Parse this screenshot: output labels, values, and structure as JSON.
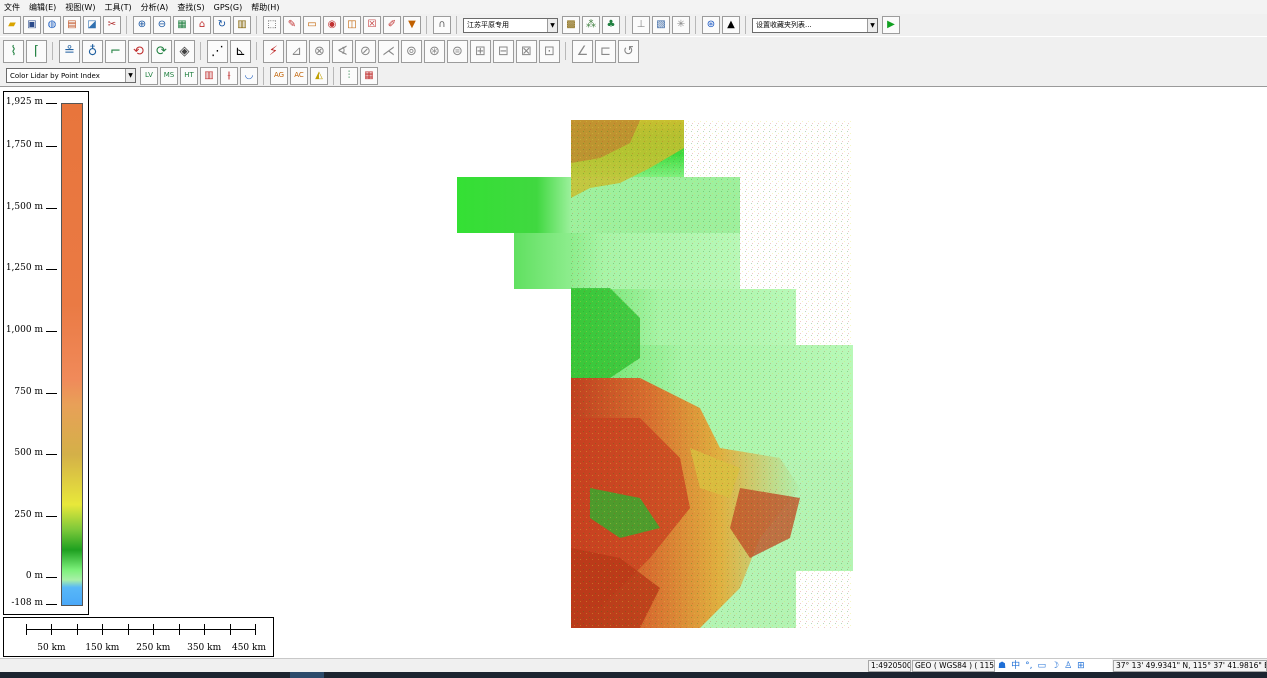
{
  "menu": [
    "文件",
    "编辑(E)",
    "视图(W)",
    "工具(T)",
    "分析(A)",
    "查找(S)",
    "GPS(G)",
    "帮助(H)"
  ],
  "toolbar1": {
    "group1_icons": [
      "open-folder-icon",
      "save-icon",
      "globe-icon",
      "layers-icon",
      "overlay-icon",
      "tools-icon"
    ],
    "group2_icons": [
      "zoom-in-icon",
      "zoom-out-icon",
      "map-view-icon",
      "home-icon",
      "refresh-icon",
      "grid-view-icon"
    ],
    "group3_icons": [
      "select-icon",
      "measure-icon",
      "ruler-icon",
      "query-icon",
      "area-icon",
      "edit-map-icon",
      "pencil-icon",
      "down-arrow-icon"
    ],
    "group4_icons": [
      "arch-icon"
    ],
    "projection_select": "江苏平原专用",
    "group5_icons": [
      "paint-icon",
      "dots-icon",
      "tree-icon"
    ],
    "group6_icons": [
      "elevation-icon",
      "export-icon",
      "star-icon"
    ],
    "group7_icons": [
      "target-icon",
      "north-arrow-icon"
    ],
    "favorites_select": "设置收藏夹列表...",
    "play_icon": "play-icon"
  },
  "toolbar2": {
    "icons": [
      "digitize-line-icon",
      "digitize-area-icon",
      "digitize-point-icon",
      "move-feature-icon",
      "edit-vertex-icon",
      "rotate-icon",
      "fill-icon",
      "dots-select-icon",
      "split-icon",
      "edit-path-icon",
      "trace-icon",
      "smooth-icon",
      "join-icon",
      "reshape-icon",
      "cut-icon",
      "merge-icon",
      "offset-icon",
      "buffer-icon",
      "intersect-icon",
      "union-icon",
      "clip-icon",
      "erase-icon",
      "simplify-icon",
      "undo-edit-icon",
      "redo-edit-icon",
      "close-edit-icon"
    ]
  },
  "toolbar3": {
    "lidar_select": "Color Lidar by Point Index",
    "icons": [
      "lidar-lv-icon",
      "lidar-ms-icon",
      "lidar-ht-icon",
      "lidar-bar-icon",
      "lidar-split-icon",
      "lidar-water-icon",
      "lidar-ag-icon",
      "lidar-ac-icon",
      "lidar-cube-icon",
      "lidar-profile-icon",
      "lidar-grid-icon"
    ]
  },
  "legend": {
    "ticks": [
      {
        "label": "1,925 m",
        "value": 1925
      },
      {
        "label": "1,750 m",
        "value": 1750
      },
      {
        "label": "1,500 m",
        "value": 1500
      },
      {
        "label": "1,250 m",
        "value": 1250
      },
      {
        "label": "1,000 m",
        "value": 1000
      },
      {
        "label": "750 m",
        "value": 750
      },
      {
        "label": "500 m",
        "value": 500
      },
      {
        "label": "250 m",
        "value": 250
      },
      {
        "label": "0 m",
        "value": 0
      },
      {
        "label": "-108 m",
        "value": -108
      }
    ],
    "range": [
      -108,
      1925
    ]
  },
  "scalebar": {
    "labels": [
      "50 km",
      "150 km",
      "250 km",
      "350 km",
      "450 km"
    ],
    "max_km": 450
  },
  "status": {
    "scale": "1:4920500",
    "projection": "GEO ( WGS84 ) ( 115",
    "ime_icons": [
      "ime-skin-icon",
      "ime-chinese-icon",
      "ime-punct-icon",
      "ime-keyboard-icon",
      "ime-moon-icon",
      "ime-user-icon",
      "ime-grid-icon"
    ],
    "ime_chinese": "中",
    "coords": "37° 13' 49.9341\" N, 115° 37' 41.9816\" E"
  }
}
